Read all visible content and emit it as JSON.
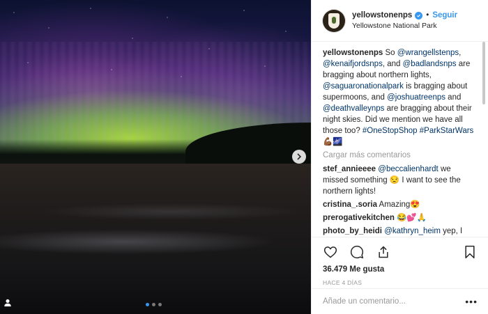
{
  "post": {
    "photo_alt": "Northern lights over Yellowstone",
    "carousel": {
      "total": 3,
      "active": 1
    }
  },
  "header": {
    "username": "yellowstonenps",
    "separator": "•",
    "follow_label": "Seguir",
    "location": "Yellowstone National Park"
  },
  "caption": {
    "username": "yellowstonenps",
    "parts": [
      {
        "text": "So ",
        "type": "text"
      },
      {
        "text": "@wrangellstenps",
        "type": "mention"
      },
      {
        "text": ", ",
        "type": "text"
      },
      {
        "text": "@kenaifjordsnps",
        "type": "mention"
      },
      {
        "text": ", and ",
        "type": "text"
      },
      {
        "text": "@badlandsnps",
        "type": "mention"
      },
      {
        "text": " are bragging about northern lights, ",
        "type": "text"
      },
      {
        "text": "@saguaronationalpark",
        "type": "mention"
      },
      {
        "text": " is bragging about supermoons, and ",
        "type": "text"
      },
      {
        "text": "@joshuatreenps",
        "type": "mention"
      },
      {
        "text": " and ",
        "type": "text"
      },
      {
        "text": "@deathvalleynps",
        "type": "mention"
      },
      {
        "text": " are bragging about their night skies. Did we mention we have all those too? ",
        "type": "text"
      },
      {
        "text": "#OneStopShop",
        "type": "mention"
      },
      {
        "text": " ",
        "type": "text"
      },
      {
        "text": "#ParkStarWars",
        "type": "mention"
      },
      {
        "text": " 💪🏾🌌",
        "type": "text"
      }
    ]
  },
  "load_more_label": "Cargar más comentarios",
  "comments": [
    {
      "username": "stef_annieeee",
      "parts": [
        {
          "text": "@beccalienhardt",
          "type": "mention"
        },
        {
          "text": " we missed something 😒 I want to see the northern lights!",
          "type": "text"
        }
      ]
    },
    {
      "username": "cristina_.soria",
      "parts": [
        {
          "text": "Amazing😍",
          "type": "text"
        }
      ]
    },
    {
      "username": "prerogativekitchen",
      "parts": [
        {
          "text": "😂💕🙏",
          "type": "text"
        }
      ]
    },
    {
      "username": "photo_by_heidi",
      "parts": [
        {
          "text": "@kathryn_heim",
          "type": "mention"
        },
        {
          "text": " yep, I have the app. I was hoping to get an answer on where the safest and best place to watch them. (Or where this photo was taken)",
          "type": "text"
        }
      ]
    }
  ],
  "likes_label": "36.479 Me gusta",
  "time_label": "HACE 4 DÍAS",
  "add_comment": {
    "placeholder": "Añade un comentario...",
    "more_label": "•••"
  },
  "icons": {
    "like": "heart-icon",
    "comment": "comment-icon",
    "share": "share-icon",
    "save": "bookmark-icon",
    "verified": "verified-badge-icon",
    "next": "chevron-right-icon",
    "user_tag": "user-tag-icon"
  },
  "colors": {
    "accent": "#3897f0",
    "mention": "#003569",
    "muted": "#999999"
  }
}
